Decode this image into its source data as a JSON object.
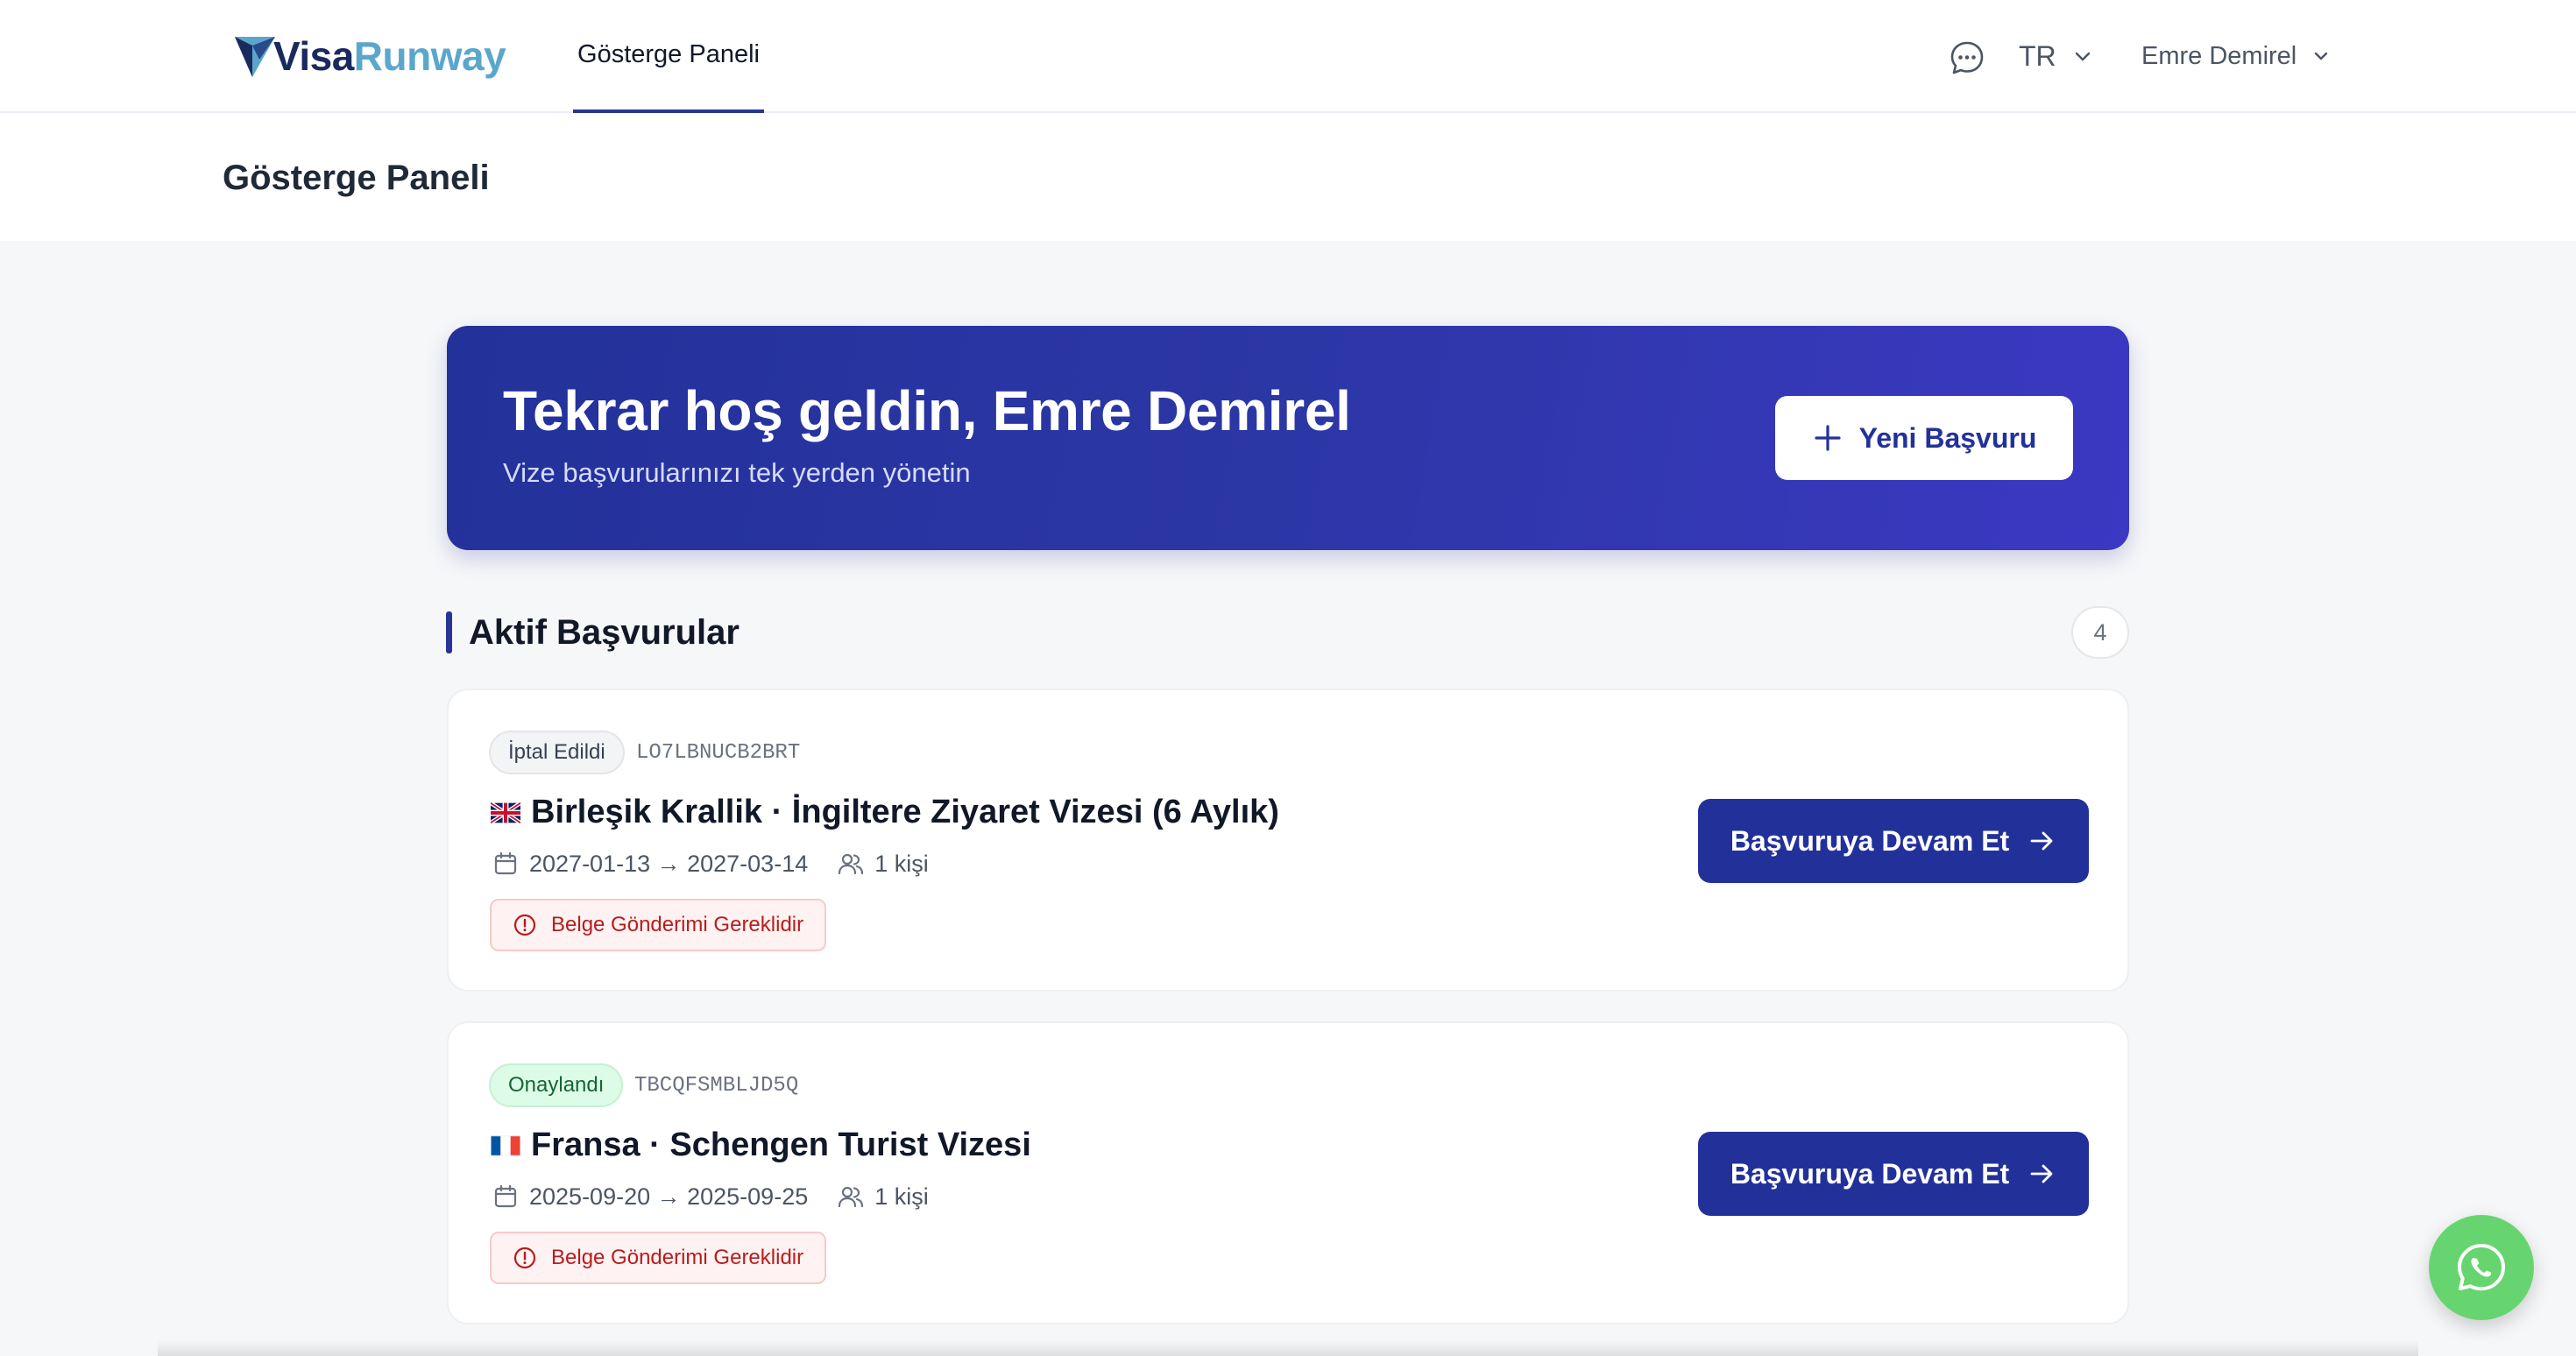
{
  "header": {
    "logo_part1": "Visa",
    "logo_part2": "Runway",
    "nav_tab": "Gösterge Paneli",
    "language": "TR",
    "user_name": "Emre Demirel"
  },
  "page": {
    "title": "Gösterge Paneli"
  },
  "banner": {
    "title": "Tekrar hoş geldin, Emre Demirel",
    "subtitle": "Vize başvurularınızı tek yerden yönetin",
    "new_button": "Yeni Başvuru"
  },
  "section": {
    "title": "Aktif Başvurular",
    "count": "4"
  },
  "applications": [
    {
      "status": "İptal Edildi",
      "status_type": "cancelled",
      "reference": "LO7LBNUCB2BRT",
      "flag": "uk-flag-icon",
      "title": "Birleşik Krallik · İngiltere Ziyaret Vizesi (6 Aylık)",
      "dates": "2027-01-13 → 2027-03-14",
      "people": "1 kişi",
      "warning": "Belge Gönderimi Gereklidir",
      "button": "Başvuruya Devam Et"
    },
    {
      "status": "Onaylandı",
      "status_type": "approved",
      "reference": "TBCQFSMBLJD5Q",
      "flag": "france-flag-icon",
      "title": "Fransa · Schengen Turist Vizesi",
      "dates": "2025-09-20 → 2025-09-25",
      "people": "1 kişi",
      "warning": "Belge Gönderimi Gereklidir",
      "button": "Başvuruya Devam Et"
    }
  ],
  "colors": {
    "primary": "#22319a",
    "logo_dark": "#1b2a5e",
    "logo_light": "#5ba7cc",
    "warning": "#b91c1c",
    "approved_bg": "#dcfce7",
    "whatsapp": "#67d56f"
  },
  "icons": {
    "chat": "chat-bubble-icon",
    "fab": "whatsapp-icon"
  }
}
